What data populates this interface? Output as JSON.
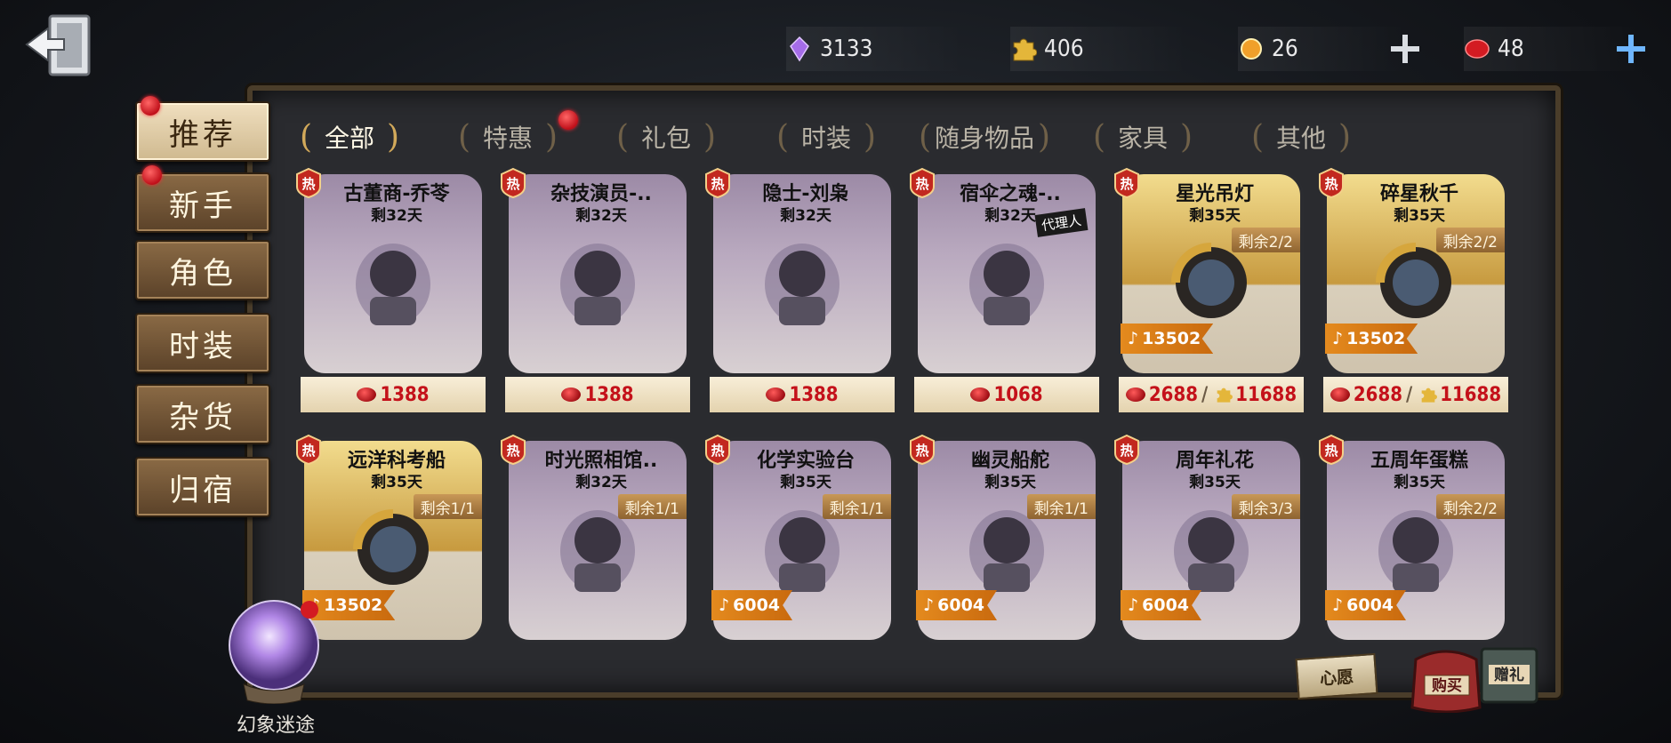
{
  "currencies": {
    "purple_crystal": "3133",
    "puzzle": "406",
    "orange_coin": "26",
    "red_coin": "48"
  },
  "side_tabs": [
    {
      "label": "推荐",
      "active": true,
      "dot": true
    },
    {
      "label": "新手",
      "active": false,
      "dot": true
    },
    {
      "label": "角色",
      "active": false,
      "dot": false
    },
    {
      "label": "时装",
      "active": false,
      "dot": false
    },
    {
      "label": "杂货",
      "active": false,
      "dot": false
    },
    {
      "label": "归宿",
      "active": false,
      "dot": false
    }
  ],
  "categories": [
    {
      "label": "全部",
      "active": true
    },
    {
      "label": "特惠",
      "active": false,
      "dot": true
    },
    {
      "label": "礼包",
      "active": false
    },
    {
      "label": "时装",
      "active": false
    },
    {
      "label": "随身物品",
      "active": false
    },
    {
      "label": "家具",
      "active": false
    },
    {
      "label": "其他",
      "active": false
    }
  ],
  "hot_label": "热",
  "items": [
    {
      "name": "古董商-乔苓",
      "days": "剩32天",
      "style": "purple",
      "price": "1388"
    },
    {
      "name": "杂技演员-..",
      "days": "剩32天",
      "style": "purple",
      "price": "1388"
    },
    {
      "name": "隐士-刘枭",
      "days": "剩32天",
      "style": "purple",
      "price": "1388"
    },
    {
      "name": "宿伞之魂-..",
      "days": "剩32天",
      "style": "purple",
      "price": "1068",
      "badge": "代理人"
    },
    {
      "name": "星光吊灯",
      "days": "剩35天",
      "style": "gold",
      "remain": "剩余2/2",
      "tag": "13502",
      "price": "2688",
      "price2": "11688"
    },
    {
      "name": "碎星秋千",
      "days": "剩35天",
      "style": "gold",
      "remain": "剩余2/2",
      "tag": "13502",
      "price": "2688",
      "price2": "11688"
    },
    {
      "name": "远洋科考船",
      "days": "剩35天",
      "style": "gold",
      "remain": "剩余1/1",
      "tag": "13502"
    },
    {
      "name": "时光照相馆..",
      "days": "剩32天",
      "style": "purple",
      "remain": "剩余1/1"
    },
    {
      "name": "化学实验台",
      "days": "剩35天",
      "style": "purple",
      "remain": "剩余1/1",
      "tag": "6004"
    },
    {
      "name": "幽灵船舵",
      "days": "剩35天",
      "style": "purple",
      "remain": "剩余1/1",
      "tag": "6004"
    },
    {
      "name": "周年礼花",
      "days": "剩35天",
      "style": "purple",
      "remain": "剩余3/3",
      "tag": "6004"
    },
    {
      "name": "五周年蛋糕",
      "days": "剩35天",
      "style": "purple",
      "remain": "剩余2/2",
      "tag": "6004"
    }
  ],
  "globe_label": "幻象迷途",
  "wish_label": "心愿",
  "buy_label": "购买",
  "gift_label": "赠礼",
  "colors": {
    "gold": "#e8c66a",
    "purple": "#8a7596",
    "accent_red": "#c4111a",
    "tag_orange": "#e48a1e"
  }
}
